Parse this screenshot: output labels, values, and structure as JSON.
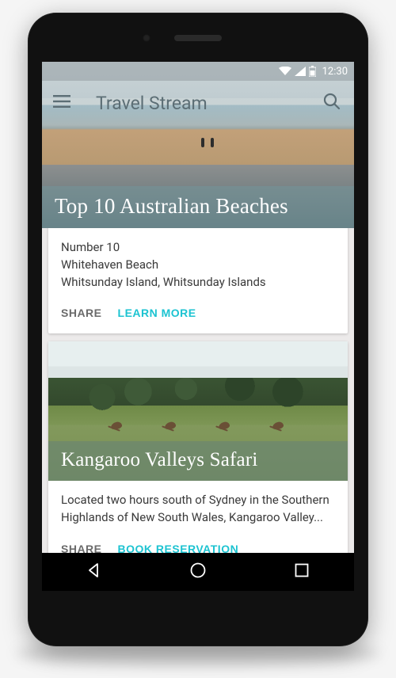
{
  "statusbar": {
    "time": "12:30"
  },
  "appbar": {
    "title": "Travel Stream"
  },
  "accent_color": "#1cc3d1",
  "cards": [
    {
      "title": "Top 10 Australian Beaches",
      "body_lines": [
        "Number 10",
        "Whitehaven Beach",
        "Whitsunday Island, Whitsunday Islands"
      ],
      "actions": {
        "share": "SHARE",
        "primary": "LEARN MORE"
      }
    },
    {
      "title": "Kangaroo Valleys Safari",
      "body": "Located two hours south of Sydney in the Southern Highlands of New South Wales, Kangaroo Valley...",
      "actions": {
        "share": "SHARE",
        "primary": "BOOK RESERVATION"
      }
    }
  ]
}
